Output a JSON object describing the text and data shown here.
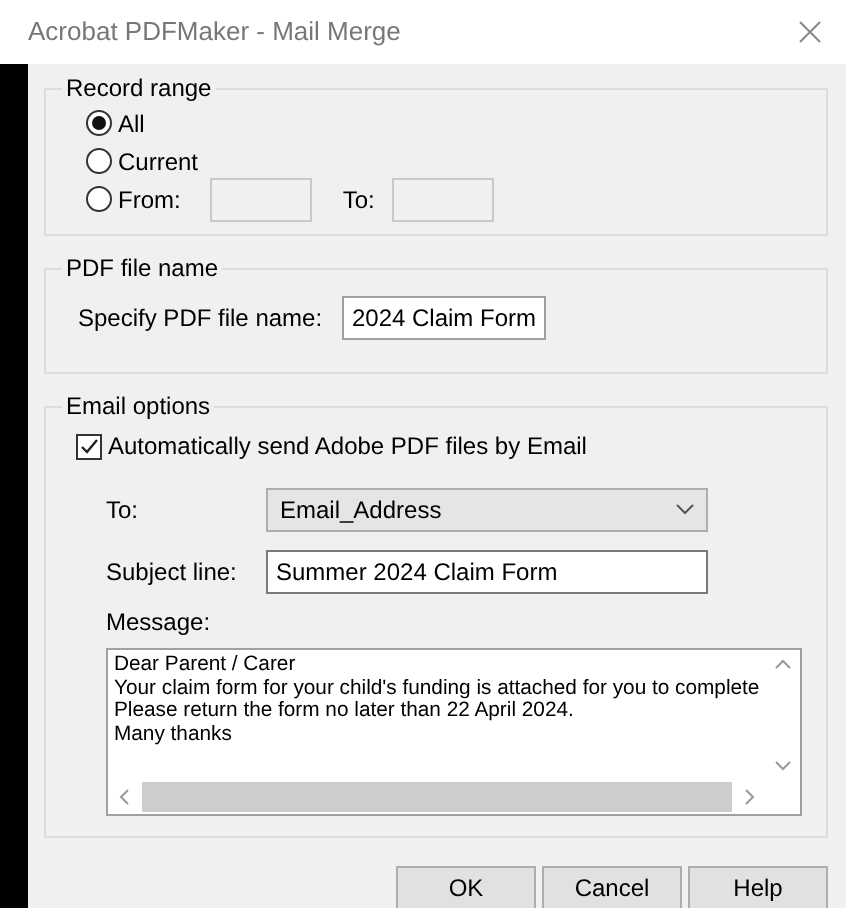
{
  "window": {
    "title": "Acrobat PDFMaker - Mail Merge"
  },
  "record_range": {
    "title": "Record range",
    "options": [
      {
        "label": "All",
        "selected": true
      },
      {
        "label": "Current",
        "selected": false
      },
      {
        "label": "From:",
        "selected": false
      }
    ],
    "to_label": "To:"
  },
  "pdf_file_name": {
    "title": "PDF file name",
    "label": "Specify PDF file name:",
    "value": "2024 Claim Form"
  },
  "email_options": {
    "title": "Email options",
    "auto_send": {
      "label": "Automatically send Adobe PDF files by Email",
      "checked": true
    },
    "to": {
      "label": "To:",
      "value": "Email_Address"
    },
    "subject": {
      "label": "Subject line:",
      "value": "Summer 2024 Claim Form"
    },
    "message": {
      "label": "Message:",
      "lines": [
        "Dear Parent / Carer",
        "Your claim form for your child's funding is attached for you to complete",
        "Please return the form no later than 22 April 2024.",
        "Many thanks"
      ]
    }
  },
  "buttons": [
    {
      "label": "OK"
    },
    {
      "label": "Cancel"
    },
    {
      "label": "Help"
    }
  ]
}
